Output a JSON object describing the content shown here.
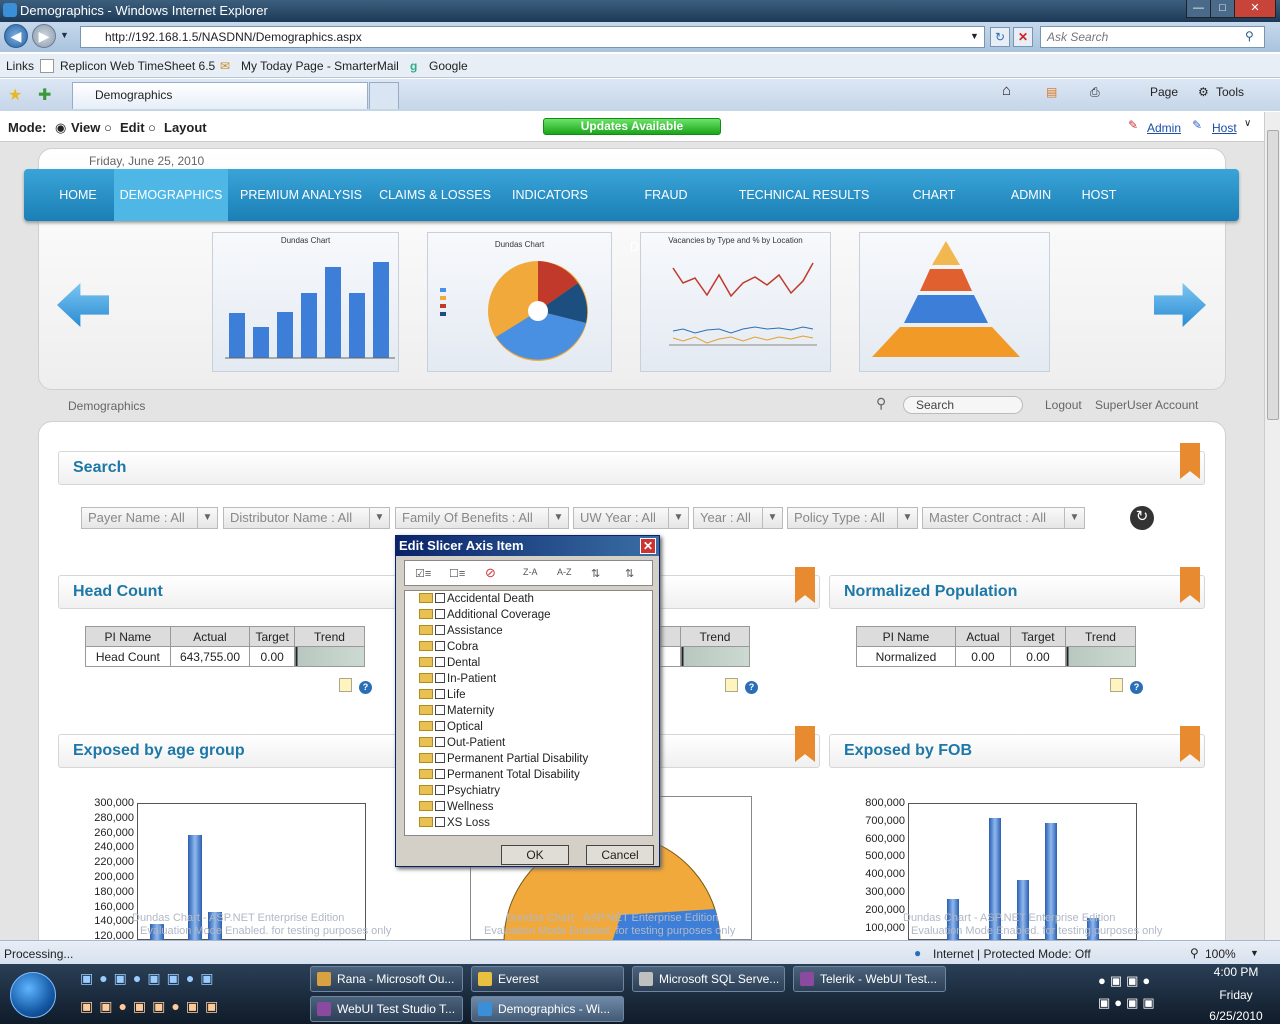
{
  "window": {
    "title": "Demographics - Windows Internet Explorer",
    "address": "http://192.168.1.5/NASDNN/Demographics.aspx",
    "search_placeholder": "Ask Search"
  },
  "links": {
    "label": "Links",
    "items": [
      "Replicon Web TimeSheet 6.5",
      "My Today Page - SmarterMail",
      "Google"
    ]
  },
  "tab": {
    "title": "Demographics"
  },
  "toolbar": {
    "page": "Page",
    "tools": "Tools"
  },
  "mode": {
    "label": "Mode:",
    "view": "View",
    "edit": "Edit",
    "layout": "Layout",
    "updates": "Updates Available",
    "admin": "Admin",
    "host": "Host"
  },
  "banner": {
    "date": "Friday, June 25, 2010"
  },
  "nav": {
    "items": [
      "HOME",
      "DEMOGRAPHICS",
      "PREMIUM ANALYSIS",
      "CLAIMS & LOSSES",
      "INDICATORS",
      "FRAUD DETECTION",
      "TECHNICAL RESULTS",
      "CHART BUILDER",
      "ADMIN",
      "HOST"
    ]
  },
  "thumbs": {
    "t1": "Dundas Chart",
    "t2": "Dundas Chart",
    "t3": "Vacancies by Type and % by Location"
  },
  "subheader": {
    "breadcrumb": "Demographics",
    "search": "Search",
    "logout": "Logout",
    "account": "SuperUser Account"
  },
  "search_panel": {
    "title": "Search",
    "filters": [
      "Payer Name : All",
      "Distributor Name : All",
      "Family Of Benefits : All",
      "UW Year : All",
      "Year : All",
      "Policy Type : All",
      "Master Contract : All"
    ]
  },
  "head_count": {
    "title": "Head Count",
    "columns": [
      "PI Name",
      "Actual",
      "Target",
      "Trend"
    ],
    "row": {
      "name": "Head Count",
      "actual": "643,755.00",
      "target": "0.00"
    }
  },
  "mid_pi": {
    "columns": [
      "Trend"
    ]
  },
  "normalized": {
    "title": "Normalized Population",
    "columns": [
      "PI Name",
      "Actual",
      "Target",
      "Trend"
    ],
    "row": {
      "name": "Normalized",
      "actual": "0.00",
      "target": "0.00"
    }
  },
  "exposed_age": {
    "title": "Exposed by age group",
    "yticks": [
      "300,000",
      "280,000",
      "260,000",
      "240,000",
      "220,000",
      "200,000",
      "180,000",
      "160,000",
      "140,000",
      "120,000"
    ],
    "watermark1": "Dundas Chart - ASP.NET Enterprise Edition",
    "watermark2": "Evaluation Mode Enabled. for testing purposes only"
  },
  "exposed_fob": {
    "title": "Exposed by FOB",
    "yticks": [
      "800,000",
      "700,000",
      "600,000",
      "500,000",
      "400,000",
      "300,000",
      "200,000",
      "100,000"
    ]
  },
  "dialog": {
    "title": "Edit Slicer Axis Item",
    "tools": [
      "Z-A",
      "A-Z"
    ],
    "items": [
      "Accidental Death",
      "Additional Coverage",
      "Assistance",
      "Cobra",
      "Dental",
      "In-Patient",
      "Life",
      "Maternity",
      "Optical",
      "Out-Patient",
      "Permanent Partial Disability",
      "Permanent Total Disability",
      "Psychiatry",
      "Wellness",
      "XS Loss"
    ],
    "ok": "OK",
    "cancel": "Cancel"
  },
  "status": {
    "text": "Processing...",
    "zone": "Internet | Protected Mode: Off",
    "zoom": "100%"
  },
  "taskbar": {
    "tasks": [
      "Rana - Microsoft Ou...",
      "Everest",
      "Microsoft SQL Serve...",
      "Telerik - WebUI Test...",
      "WebUI Test Studio T...",
      "Demographics - Wi..."
    ],
    "time": "4:00 PM",
    "day": "Friday",
    "date": "6/25/2010"
  },
  "colors": {
    "accent": "#1d78a8",
    "nav": "#2b92c8",
    "bookmark": "#e88a30"
  }
}
